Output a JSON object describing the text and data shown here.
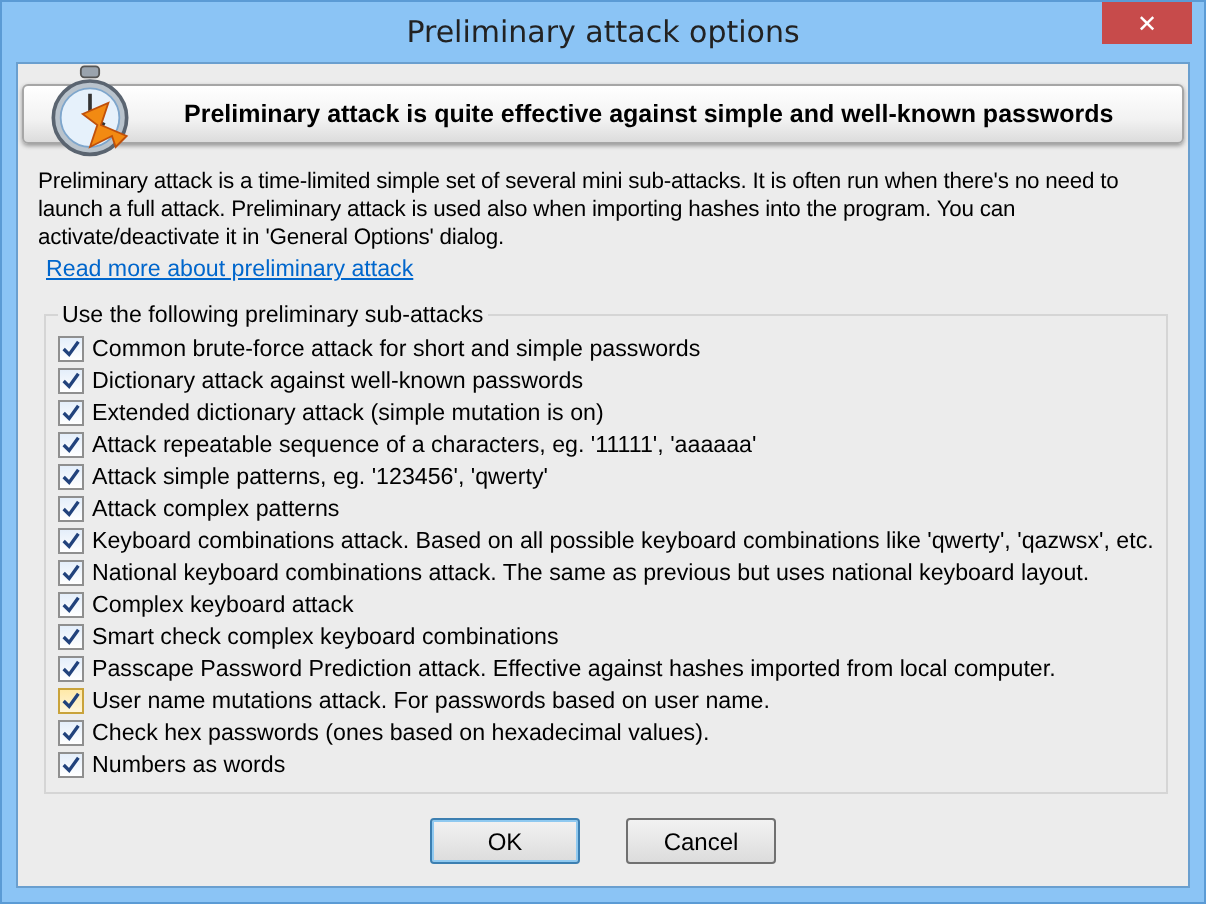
{
  "window": {
    "title": "Preliminary attack options",
    "close": "✕"
  },
  "banner": {
    "text": "Preliminary attack is quite effective against simple and well-known passwords"
  },
  "description": "Preliminary attack is a time-limited simple set of several mini sub-attacks. It is often run when there's no need to launch a full attack. Preliminary attack is used also when importing hashes into the program. You can activate/deactivate it in 'General Options' dialog.",
  "link": "Read more about preliminary attack",
  "group": {
    "title": "Use the following preliminary sub-attacks",
    "items": [
      {
        "label": "Common brute-force attack for short and simple passwords",
        "checked": true,
        "hovered": false
      },
      {
        "label": "Dictionary attack against well-known passwords",
        "checked": true,
        "hovered": false
      },
      {
        "label": "Extended dictionary attack (simple mutation is on)",
        "checked": true,
        "hovered": false
      },
      {
        "label": "Attack repeatable sequence of a characters, eg. '11111', 'aaaaaa'",
        "checked": true,
        "hovered": false
      },
      {
        "label": "Attack simple patterns, eg. '123456', 'qwerty'",
        "checked": true,
        "hovered": false
      },
      {
        "label": "Attack complex patterns",
        "checked": true,
        "hovered": false
      },
      {
        "label": "Keyboard combinations attack. Based on all possible keyboard combinations like 'qwerty', 'qazwsx', etc.",
        "checked": true,
        "hovered": false
      },
      {
        "label": "National keyboard combinations attack. The same as previous but uses national keyboard layout.",
        "checked": true,
        "hovered": false
      },
      {
        "label": "Complex keyboard attack",
        "checked": true,
        "hovered": false
      },
      {
        "label": "Smart check complex keyboard combinations",
        "checked": true,
        "hovered": false
      },
      {
        "label": "Passcape Password Prediction attack. Effective against hashes imported from local computer.",
        "checked": true,
        "hovered": false
      },
      {
        "label": "User name mutations attack. For passwords based on user name.",
        "checked": true,
        "hovered": true
      },
      {
        "label": "Check hex passwords (ones based on hexadecimal values).",
        "checked": true,
        "hovered": false
      },
      {
        "label": "Numbers as words",
        "checked": true,
        "hovered": false
      }
    ]
  },
  "buttons": [
    "OK",
    "Cancel"
  ]
}
